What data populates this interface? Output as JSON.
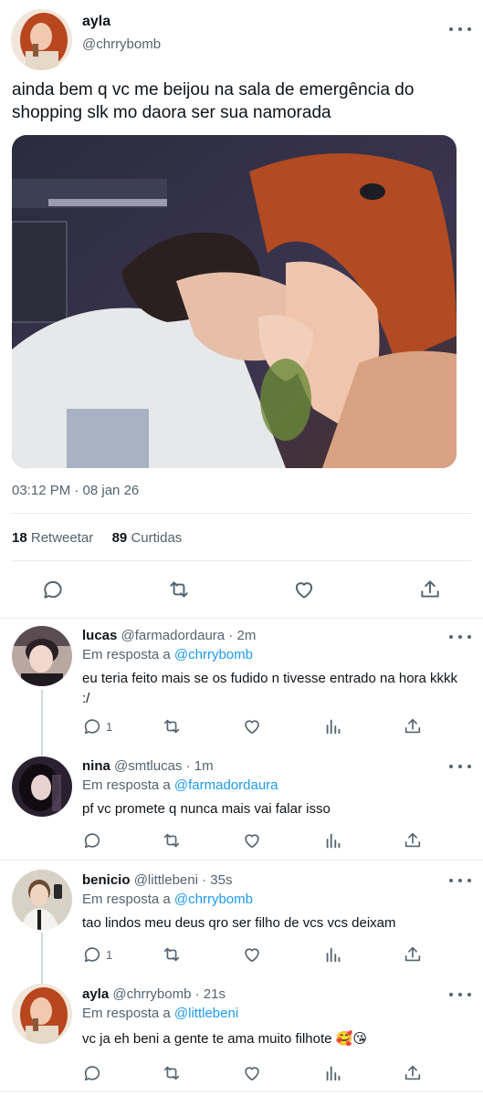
{
  "tweet": {
    "name": "ayla",
    "handle": "@chrrybomb",
    "text": "ainda bem q vc me beijou na sala de emergência do shopping slk mo daora ser sua namorada",
    "timestamp": "03:12 PM · 08 jan 26",
    "retweets_count": "18",
    "retweets_label": "Retweetar",
    "likes_count": "89",
    "likes_label": "Curtidas"
  },
  "reply_prefix": "Em resposta a",
  "replies": [
    {
      "name": "lucas",
      "meta": "@farmadordaura · 2m",
      "reply_to": "@chrrybomb",
      "text": "eu teria feito mais se os fudido n tivesse entrado na hora kkkk :/",
      "reply_count": "1"
    },
    {
      "name": "nina",
      "meta": "@smtlucas · 1m",
      "reply_to": "@farmadordaura",
      "text": "pf vc promete q nunca mais vai falar isso",
      "reply_count": ""
    },
    {
      "name": "benicio",
      "meta": "@littlebeni · 35s",
      "reply_to": "@chrrybomb",
      "text": "tao lindos meu deus qro ser filho de vcs vcs deixam",
      "reply_count": "1"
    },
    {
      "name": "ayla",
      "meta": "@chrrybomb · 21s",
      "reply_to": "@littlebeni",
      "text": "vc ja eh beni a gente te ama muito filhote 🥰😘",
      "reply_count": ""
    }
  ],
  "colors": {
    "link": "#1d9bf0",
    "secondary_text": "#536471",
    "divider": "#e6ecf0"
  }
}
